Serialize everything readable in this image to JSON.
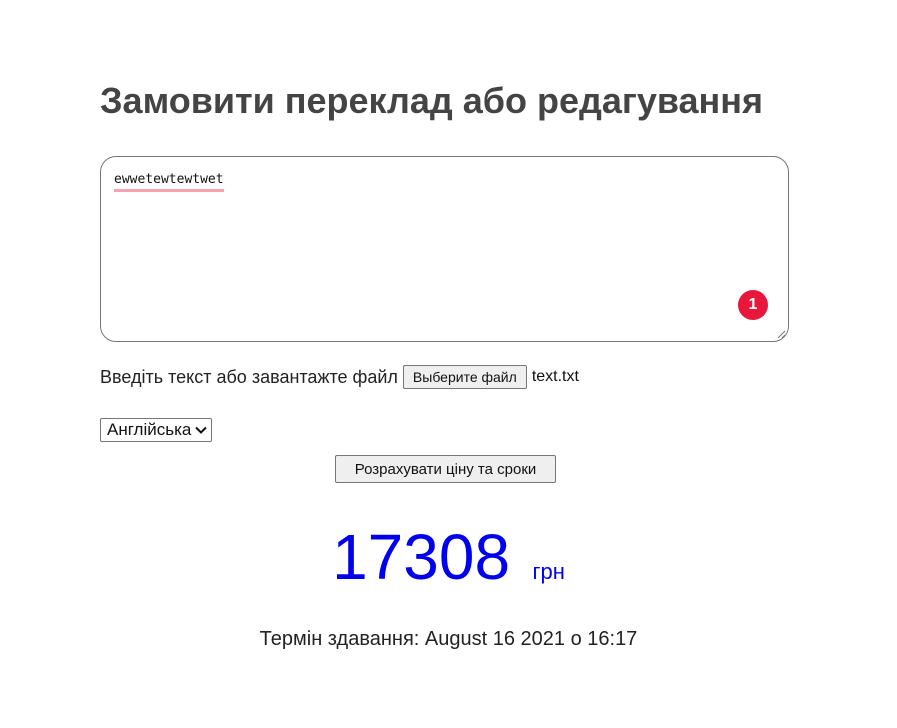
{
  "form": {
    "title": "Замовити переклад або редагування",
    "textarea_value": "ewwetewtewtwet",
    "badge_count": "1",
    "file_label": "Введіть текст або завантажте файл",
    "file_button": "Выберите файл",
    "file_name": "text.txt",
    "language_selected": "Англійська",
    "calc_button": "Розрахувати ціну та сроки"
  },
  "result": {
    "price": "17308",
    "currency": "грн",
    "deadline_label": "Термін здавання:",
    "deadline_value": "August 16 2021 о 16:17"
  },
  "colors": {
    "price": "#0000ee",
    "badge": "#e8173b",
    "title": "#444444"
  }
}
